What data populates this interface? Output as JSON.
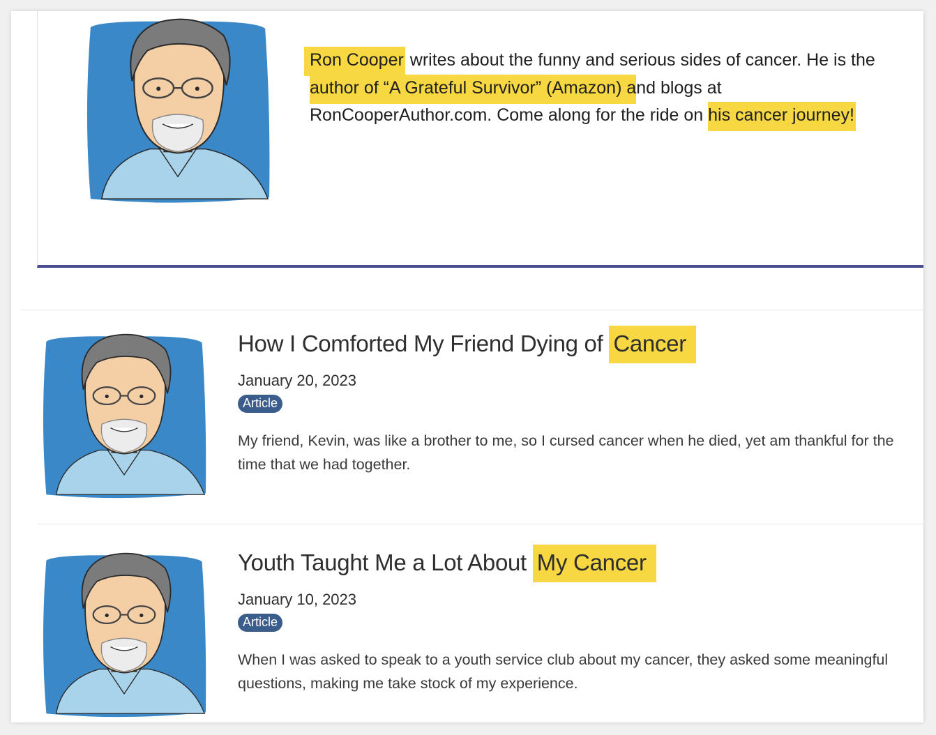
{
  "bio": {
    "name": "Ron Cooper",
    "t1": " writes about the funny and serious sides of cancer. He is the ",
    "book": "author of “A Grateful Survivor” (Amazon) a",
    "t2": "nd blogs at RonCooperAuthor.com. Come along for the ride on ",
    "journey": "his cancer journey!"
  },
  "posts": [
    {
      "title_prefix": "How I Comforted My Friend Dying of ",
      "title_highlight": "Cancer",
      "date": "January 20, 2023",
      "badge": "Article",
      "excerpt": "My friend, Kevin, was like a brother to me, so I cursed cancer when he died, yet am thankful for the time that we had together."
    },
    {
      "title_prefix": "Youth Taught Me a Lot About ",
      "title_highlight": "My Cancer",
      "date": "January 10, 2023",
      "badge": "Article",
      "excerpt": "When I was asked to speak to a youth service club about my cancer, they asked some meaningful questions, making me take stock of my experience."
    }
  ],
  "colors": {
    "highlight": "#f7d842",
    "badge": "#3b5d8c",
    "divider": "#4a4d8e",
    "portrait_bg": "#3b88c8",
    "shirt": "#a9d3ea"
  }
}
